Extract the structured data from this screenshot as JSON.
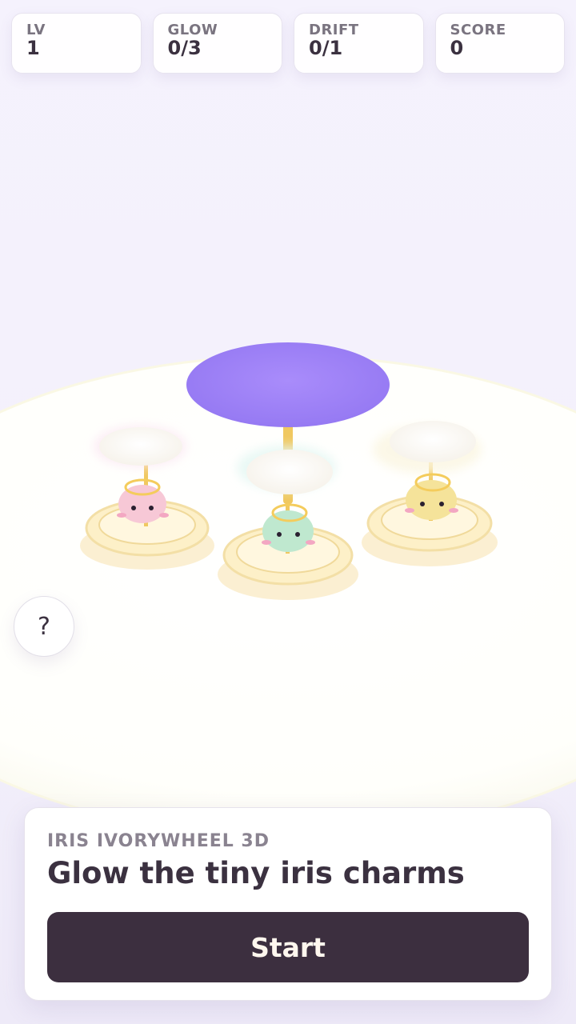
{
  "hud": [
    {
      "label": "LV",
      "value": "1"
    },
    {
      "label": "GLOW",
      "value": "0/3"
    },
    {
      "label": "DRIFT",
      "value": "0/1"
    },
    {
      "label": "SCORE",
      "value": "0"
    }
  ],
  "help_button": "?",
  "panel": {
    "subtitle": "IRIS IVORYWHEEL 3D",
    "title": "Glow the tiny iris charms",
    "start_label": "Start"
  },
  "charms": [
    {
      "color": "pink",
      "body_hex": "#f7c8d6"
    },
    {
      "color": "mint",
      "body_hex": "#bfe8cf"
    },
    {
      "color": "yellow",
      "body_hex": "#f5e39a"
    }
  ],
  "colors": {
    "canopy": "#9d80f6",
    "pole": "#f0c860",
    "base": "#fbeec0",
    "dark_button": "#3c2f3f"
  }
}
